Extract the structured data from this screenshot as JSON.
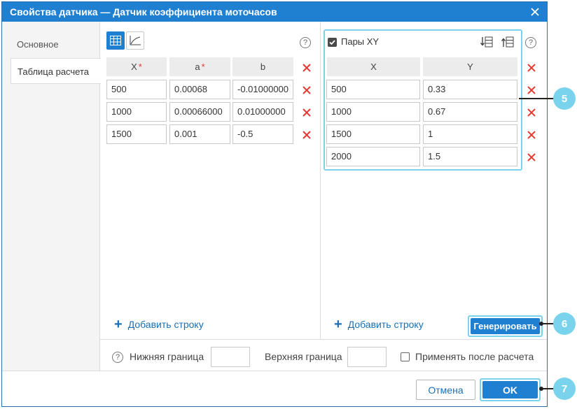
{
  "dialog": {
    "title": "Свойства датчика — Датчик коэффициента моточасов",
    "close_icon": "close-icon"
  },
  "tabs": [
    {
      "label": "Основное",
      "active": false
    },
    {
      "label": "Таблица расчета",
      "active": true
    }
  ],
  "left_table": {
    "view_buttons": [
      "table-view-icon",
      "chart-view-icon"
    ],
    "columns": [
      {
        "label": "X",
        "required": "*"
      },
      {
        "label": "a",
        "required": "*"
      },
      {
        "label": "b",
        "required": ""
      }
    ],
    "rows": [
      [
        "500",
        "0.00068",
        "-0.01000000"
      ],
      [
        "1000",
        "0.00066000",
        "0.01000000"
      ],
      [
        "1500",
        "0.001",
        "-0.5"
      ]
    ],
    "add_row_label": "Добавить строку"
  },
  "xy_pairs": {
    "checkbox_label": "Пары XY",
    "checked": true,
    "columns": [
      "X",
      "Y"
    ],
    "rows": [
      [
        "500",
        "0.33"
      ],
      [
        "1000",
        "0.67"
      ],
      [
        "1500",
        "1"
      ],
      [
        "2000",
        "1.5"
      ]
    ],
    "add_row_label": "Добавить строку",
    "generate_label": "Генерировать"
  },
  "bounds": {
    "lower_label": "Нижняя граница",
    "upper_label": "Верхняя граница",
    "apply_label": "Применять после расчета"
  },
  "footer": {
    "cancel_label": "Отмена",
    "ok_label": "OK"
  },
  "callouts": [
    "5",
    "6",
    "7"
  ],
  "colors": {
    "accent": "#1f7fd0",
    "highlight": "#7ad3ec",
    "delete": "#e53935"
  }
}
